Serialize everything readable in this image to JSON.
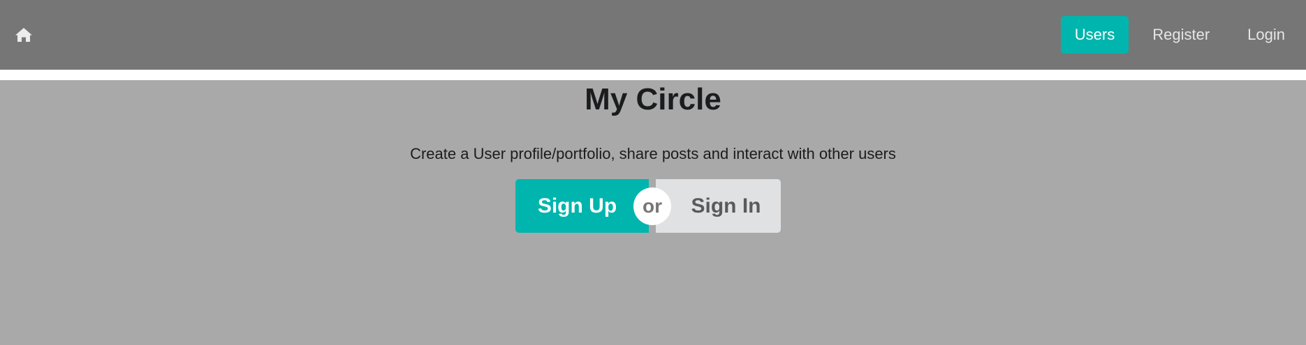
{
  "navbar": {
    "home_icon": "home-icon",
    "items": [
      {
        "label": "Users",
        "active": true
      },
      {
        "label": "Register",
        "active": false
      },
      {
        "label": "Login",
        "active": false
      }
    ]
  },
  "hero": {
    "title": "My Circle",
    "subtitle": "Create a User profile/portfolio, share posts and interact with other users",
    "signup_label": "Sign Up",
    "or_label": "or",
    "signin_label": "Sign In"
  },
  "colors": {
    "navbar": "#767676",
    "accent": "#00b5ad",
    "background": "#a9a9a9",
    "secondary_button": "#e0e1e2"
  }
}
